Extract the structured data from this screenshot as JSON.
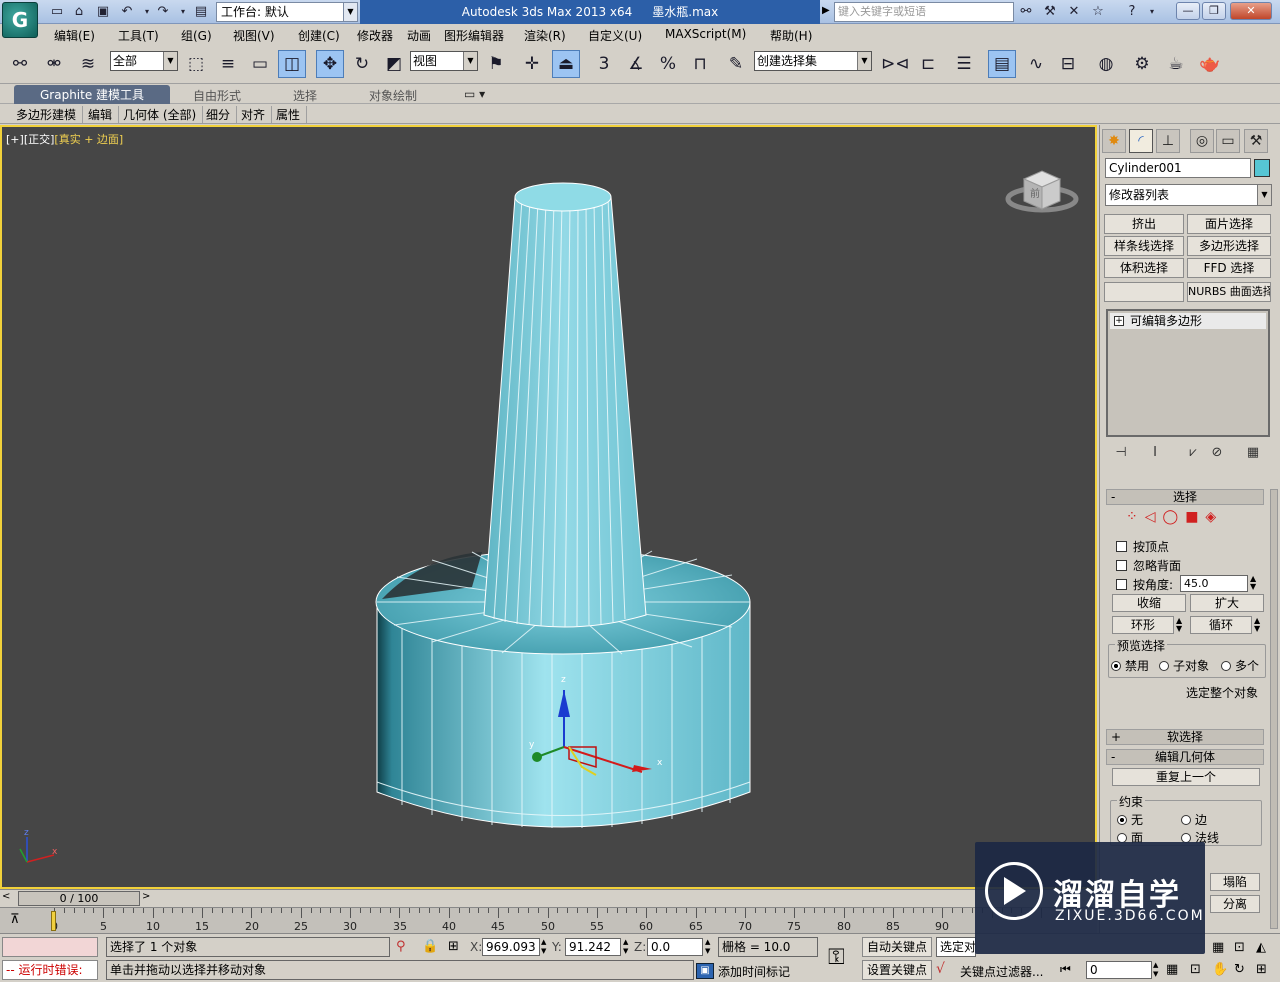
{
  "titlebar": {
    "app_icon_label": "G",
    "workspace": "工作台: 默认",
    "app_title": "Autodesk 3ds Max  2013 x64",
    "file_name": "墨水瓶.max",
    "search_placeholder": "键入关键字或短语"
  },
  "menu": [
    "编辑(E)",
    "工具(T)",
    "组(G)",
    "视图(V)",
    "创建(C)",
    "修改器",
    "动画",
    "图形编辑器",
    "渲染(R)",
    "自定义(U)",
    "MAXScript(M)",
    "帮助(H)"
  ],
  "toolbar": {
    "selection_filter": "全部",
    "ref_coord": "视图",
    "named_selection": "创建选择集",
    "snap_label": "3",
    "percent_label": "%"
  },
  "ribbon": {
    "tabs": [
      "Graphite 建模工具",
      "自由形式",
      "选择",
      "对象绘制"
    ],
    "sub_tabs": [
      "多边形建模",
      "编辑",
      "几何体 (全部)",
      "细分",
      "对齐",
      "属性"
    ]
  },
  "viewport": {
    "label_bracket": "[+]",
    "label_view": "[正交]",
    "label_shading": "[真实 + 边面]",
    "viewcube_face": "前",
    "gizmo_x": "x",
    "gizmo_y": "y",
    "gizmo_z": "z",
    "axis_x": "x",
    "axis_z": "z"
  },
  "command_panel": {
    "object_name": "Cylinder001",
    "object_color": "#56c6d4",
    "modifier_list": "修改器列表",
    "mod_buttons": [
      "挤出",
      "面片选择",
      "样条线选择",
      "多边形选择",
      "体积选择",
      "FFD 选择",
      "",
      "NURBS 曲面选择"
    ],
    "stack_item": "可编辑多边形",
    "selection": {
      "title": "选择",
      "by_vertex": "按顶点",
      "ignore_backfacing": "忽略背面",
      "by_angle": "按角度:",
      "angle_value": "45.0",
      "shrink": "收缩",
      "grow": "扩大",
      "ring": "环形",
      "loop": "循环",
      "preview_label": "预览选择",
      "preview_off": "禁用",
      "preview_sub": "子对象",
      "preview_multi": "多个",
      "select_whole": "选定整个对象"
    },
    "soft_selection": "软选择",
    "edit_geometry": "编辑几何体",
    "repeat_last": "重复上一个",
    "constraints": {
      "label": "约束",
      "none": "无",
      "edge": "边",
      "face": "面",
      "normal": "法线"
    },
    "collapse": "塌陷",
    "detach": "分离"
  },
  "timeline": {
    "position": "0 / 100",
    "ticks": [
      "0",
      "5",
      "10",
      "15",
      "20",
      "25",
      "30",
      "35",
      "40",
      "45",
      "50",
      "55",
      "60",
      "65",
      "70",
      "75",
      "80",
      "85",
      "90"
    ]
  },
  "status": {
    "script_error": "-- 运行时错误:",
    "selected": "选择了 1 个对象",
    "prompt": "单击并拖动以选择并移动对象",
    "x_label": "X:",
    "x": "969.093",
    "y_label": "Y:",
    "y": "91.242",
    "z_label": "Z:",
    "z": "0.0",
    "grid": "栅格 = 10.0",
    "auto_key": "自动关键点",
    "selected_set": "选定对",
    "set_key": "设置关键点",
    "key_filters": "关键点过滤器...",
    "add_time_tag": "添加时间标记",
    "frame": "0"
  },
  "watermark": {
    "name_cn": "溜溜自学",
    "name_en": "ZIXUE.3D66.COM"
  }
}
